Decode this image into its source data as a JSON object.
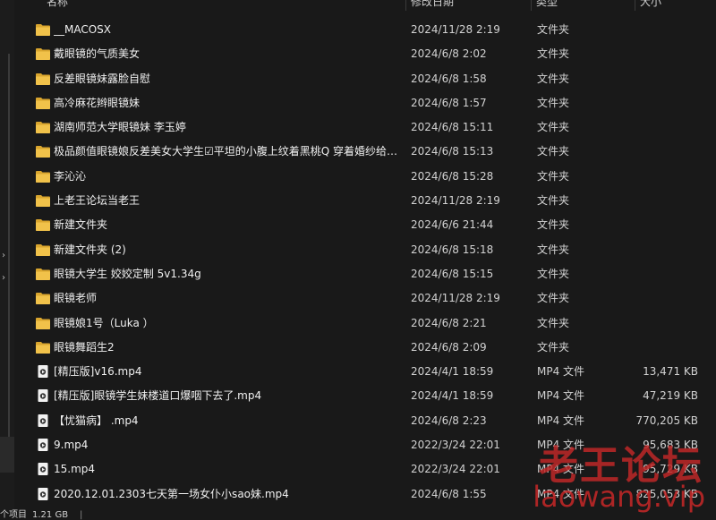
{
  "columns": {
    "name": "名称",
    "modified": "修改日期",
    "type": "类型",
    "size": "大小"
  },
  "colors": {
    "folder": "#e8b73a",
    "background": "#191919",
    "watermark": "#c22a2a"
  },
  "rows": [
    {
      "icon": "folder-icon",
      "name": "__MACOSX",
      "date": "2024/11/28 2:19",
      "type": "文件夹",
      "size": ""
    },
    {
      "icon": "folder-icon",
      "name": "戴眼镜的气质美女",
      "date": "2024/6/8 2:02",
      "type": "文件夹",
      "size": ""
    },
    {
      "icon": "folder-icon",
      "name": "反差眼镜妹露脸自慰",
      "date": "2024/6/8 1:58",
      "type": "文件夹",
      "size": ""
    },
    {
      "icon": "folder-icon",
      "name": "高冷麻花辫眼镜妹",
      "date": "2024/6/8 1:57",
      "type": "文件夹",
      "size": ""
    },
    {
      "icon": "folder-icon",
      "name": "湖南师范大学眼镜妹 李玉婷",
      "date": "2024/6/8 15:11",
      "type": "文件夹",
      "size": ""
    },
    {
      "icon": "folder-icon",
      "name": "极品颜值眼镜娘反差美女大学生☑平坦的小腹上纹着黑桃Q 穿着婚纱给…",
      "date": "2024/6/8 15:13",
      "type": "文件夹",
      "size": ""
    },
    {
      "icon": "folder-icon",
      "name": "李沁沁",
      "date": "2024/6/8 15:28",
      "type": "文件夹",
      "size": ""
    },
    {
      "icon": "folder-icon",
      "name": "上老王论坛当老王",
      "date": "2024/11/28 2:19",
      "type": "文件夹",
      "size": ""
    },
    {
      "icon": "folder-icon",
      "name": "新建文件夹",
      "date": "2024/6/6 21:44",
      "type": "文件夹",
      "size": ""
    },
    {
      "icon": "folder-icon",
      "name": "新建文件夹 (2)",
      "date": "2024/6/8 15:18",
      "type": "文件夹",
      "size": ""
    },
    {
      "icon": "folder-icon",
      "name": "眼镜大学生 姣姣定制 5v1.34g",
      "date": "2024/6/8 15:15",
      "type": "文件夹",
      "size": ""
    },
    {
      "icon": "folder-icon",
      "name": "眼镜老师",
      "date": "2024/11/28 2:19",
      "type": "文件夹",
      "size": ""
    },
    {
      "icon": "folder-icon",
      "name": "眼镜娘1号（Luka ）",
      "date": "2024/6/8 2:21",
      "type": "文件夹",
      "size": ""
    },
    {
      "icon": "folder-icon",
      "name": "眼镜舞蹈生2",
      "date": "2024/6/8 2:09",
      "type": "文件夹",
      "size": ""
    },
    {
      "icon": "video-file-icon",
      "name": "[精压版]v16.mp4",
      "date": "2024/4/1 18:59",
      "type": "MP4 文件",
      "size": "13,471 KB"
    },
    {
      "icon": "video-file-icon",
      "name": "[精压版]眼镜学生妹楼道口爆咽下去了.mp4",
      "date": "2024/4/1 18:59",
      "type": "MP4 文件",
      "size": "47,219 KB"
    },
    {
      "icon": "video-file-icon",
      "name": "【忧猫病】 .mp4",
      "date": "2024/6/8 2:23",
      "type": "MP4 文件",
      "size": "770,205 KB"
    },
    {
      "icon": "video-file-icon",
      "name": "9.mp4",
      "date": "2022/3/24 22:01",
      "type": "MP4 文件",
      "size": "95,683 KB"
    },
    {
      "icon": "video-file-icon",
      "name": "15.mp4",
      "date": "2022/3/24 22:01",
      "type": "MP4 文件",
      "size": "95,729 KB"
    },
    {
      "icon": "video-file-icon",
      "name": "2020.12.01.2303七天第一场女仆小sao妹.mp4",
      "date": "2024/6/8 1:55",
      "type": "MP4 文件",
      "size": "825,053 KB"
    }
  ],
  "status": {
    "items": "个项目",
    "size": "1.21 GB"
  },
  "watermark": {
    "line1": "老王论坛",
    "line2": "laowang.vip"
  }
}
